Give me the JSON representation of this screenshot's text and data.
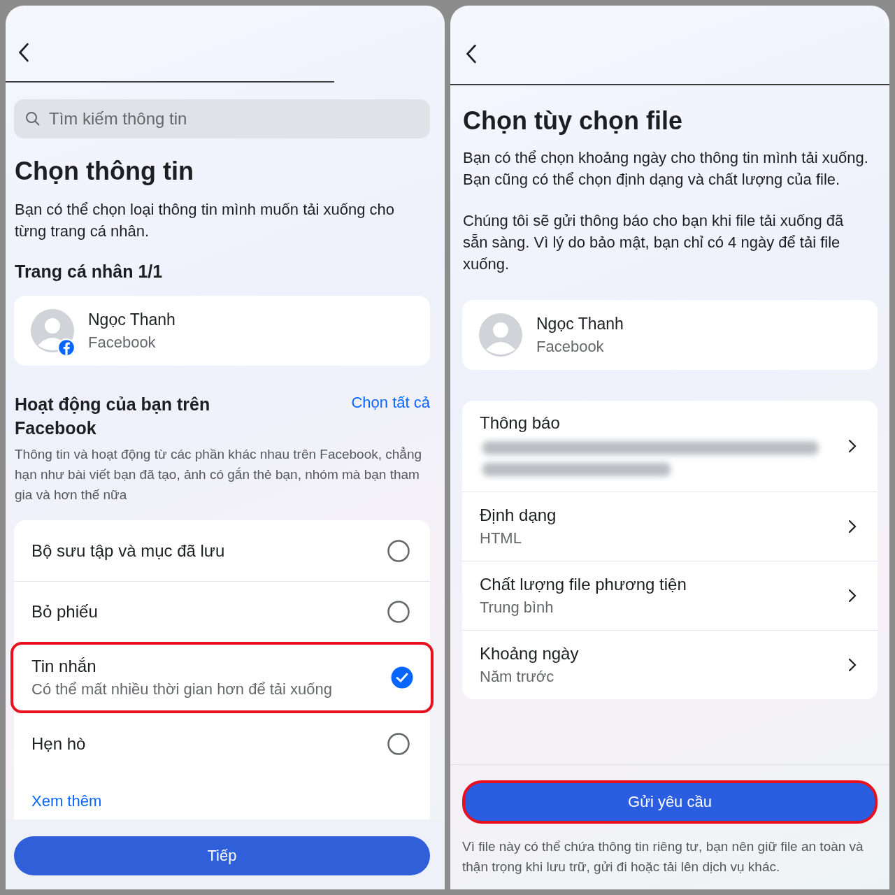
{
  "left_screen": {
    "search": {
      "placeholder": "Tìm kiếm thông tin"
    },
    "title": "Chọn thông tin",
    "description": "Bạn có thể chọn loại thông tin mình muốn tải xuống cho từng trang cá nhân.",
    "profile_heading": "Trang cá nhân 1/1",
    "profile": {
      "name": "Ngọc Thanh",
      "network": "Facebook",
      "network_badge": true
    },
    "activity": {
      "title": "Hoạt động của bạn trên Facebook",
      "select_all": "Chọn tất cả",
      "description": "Thông tin và hoạt động từ các phần khác nhau trên Facebook, chẳng hạn như bài viết bạn đã tạo, ảnh có gắn thẻ bạn, nhóm mà bạn tham gia và hơn thế nữa"
    },
    "options": [
      {
        "label": "Bộ sưu tập và mục đã lưu",
        "checked": false,
        "highlighted": false
      },
      {
        "label": "Bỏ phiếu",
        "checked": false,
        "highlighted": false
      },
      {
        "label": "Tin nhắn",
        "sublabel": "Có thể mất nhiều thời gian hơn để tải xuống",
        "checked": true,
        "highlighted": true
      },
      {
        "label": "Hẹn hò",
        "checked": false,
        "highlighted": false
      }
    ],
    "see_more": "Xem thêm",
    "next_button": "Tiếp"
  },
  "right_screen": {
    "title": "Chọn tùy chọn file",
    "paragraphs": [
      "Bạn có thể chọn khoảng ngày cho thông tin mình tải xuống. Bạn cũng có thể chọn định dạng và chất lượng của file.",
      "Chúng tôi sẽ gửi thông báo cho bạn khi file tải xuống đã sẵn sàng. Vì lý do bảo mật, bạn chỉ có 4 ngày để tải file xuống."
    ],
    "profile": {
      "name": "Ngọc Thanh",
      "network": "Facebook",
      "network_badge": false
    },
    "settings": [
      {
        "label": "Thông báo",
        "kind": "blurred"
      },
      {
        "label": "Định dạng",
        "value": "HTML",
        "kind": "text"
      },
      {
        "label": "Chất lượng file phương tiện",
        "value": "Trung bình",
        "kind": "text"
      },
      {
        "label": "Khoảng ngày",
        "value": "Năm trước",
        "kind": "text"
      }
    ],
    "submit_button": {
      "label": "Gửi yêu cầu",
      "highlighted": true
    },
    "footer": "Vì file này có thể chứa thông tin riêng tư, bạn nên giữ file an toàn và thận trọng khi lưu trữ, gửi đi hoặc tải lên dịch vụ khác."
  }
}
